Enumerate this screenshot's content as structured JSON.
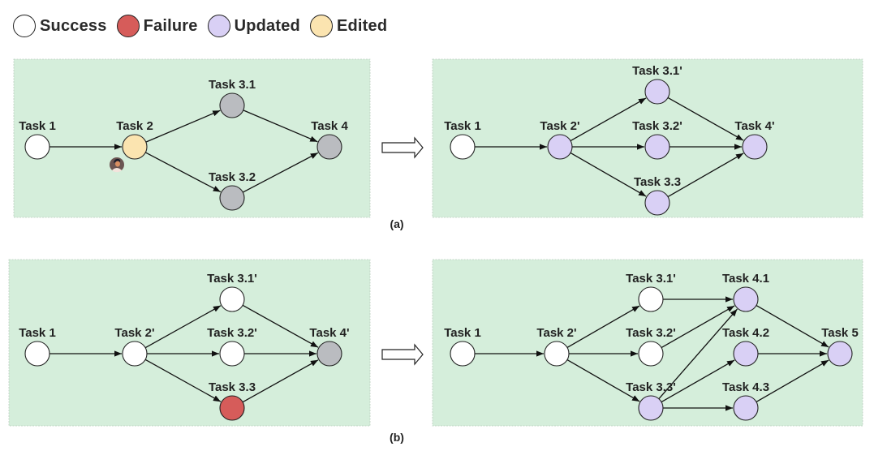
{
  "legend": [
    {
      "label": "Success",
      "status": "success"
    },
    {
      "label": "Failure",
      "status": "failure"
    },
    {
      "label": "Updated",
      "status": "updated"
    },
    {
      "label": "Edited",
      "status": "edited"
    }
  ],
  "status_colors": {
    "success": "#ffffff",
    "failure": "#d65c5a",
    "updated": "#d9d0f5",
    "edited": "#fbe4b0",
    "pending": "#babcc0"
  },
  "panel_color": "#d5eedb",
  "captions": {
    "a": "(a)",
    "b": "(b)"
  },
  "panels": [
    {
      "id": "a-before",
      "nodes": [
        {
          "id": "t1",
          "label": "Task 1",
          "status": "success"
        },
        {
          "id": "t2",
          "label": "Task 2",
          "status": "edited",
          "has_user_avatar": true
        },
        {
          "id": "t31",
          "label": "Task 3.1",
          "status": "pending"
        },
        {
          "id": "t32",
          "label": "Task 3.2",
          "status": "pending"
        },
        {
          "id": "t4",
          "label": "Task 4",
          "status": "pending"
        }
      ],
      "edges": [
        [
          "t1",
          "t2"
        ],
        [
          "t2",
          "t31"
        ],
        [
          "t2",
          "t32"
        ],
        [
          "t31",
          "t4"
        ],
        [
          "t32",
          "t4"
        ]
      ]
    },
    {
      "id": "a-after",
      "nodes": [
        {
          "id": "t1",
          "label": "Task 1",
          "status": "success"
        },
        {
          "id": "t2",
          "label": "Task 2'",
          "status": "updated"
        },
        {
          "id": "t31",
          "label": "Task 3.1'",
          "status": "updated"
        },
        {
          "id": "t32",
          "label": "Task 3.2'",
          "status": "updated"
        },
        {
          "id": "t33",
          "label": "Task 3.3",
          "status": "updated"
        },
        {
          "id": "t4",
          "label": "Task 4'",
          "status": "updated"
        }
      ],
      "edges": [
        [
          "t1",
          "t2"
        ],
        [
          "t2",
          "t31"
        ],
        [
          "t2",
          "t32"
        ],
        [
          "t2",
          "t33"
        ],
        [
          "t31",
          "t4"
        ],
        [
          "t32",
          "t4"
        ],
        [
          "t33",
          "t4"
        ]
      ]
    },
    {
      "id": "b-before",
      "nodes": [
        {
          "id": "t1",
          "label": "Task 1",
          "status": "success"
        },
        {
          "id": "t2",
          "label": "Task 2'",
          "status": "success"
        },
        {
          "id": "t31",
          "label": "Task 3.1'",
          "status": "success"
        },
        {
          "id": "t32",
          "label": "Task 3.2'",
          "status": "success"
        },
        {
          "id": "t33",
          "label": "Task 3.3",
          "status": "failure"
        },
        {
          "id": "t4",
          "label": "Task 4'",
          "status": "pending"
        }
      ],
      "edges": [
        [
          "t1",
          "t2"
        ],
        [
          "t2",
          "t31"
        ],
        [
          "t2",
          "t32"
        ],
        [
          "t2",
          "t33"
        ],
        [
          "t31",
          "t4"
        ],
        [
          "t32",
          "t4"
        ],
        [
          "t33",
          "t4"
        ]
      ]
    },
    {
      "id": "b-after",
      "nodes": [
        {
          "id": "t1",
          "label": "Task 1",
          "status": "success"
        },
        {
          "id": "t2",
          "label": "Task 2'",
          "status": "success"
        },
        {
          "id": "t31",
          "label": "Task 3.1'",
          "status": "success"
        },
        {
          "id": "t32",
          "label": "Task 3.2'",
          "status": "success"
        },
        {
          "id": "t33",
          "label": "Task 3.3'",
          "status": "updated"
        },
        {
          "id": "t41",
          "label": "Task 4.1",
          "status": "updated"
        },
        {
          "id": "t42",
          "label": "Task 4.2",
          "status": "updated"
        },
        {
          "id": "t43",
          "label": "Task 4.3",
          "status": "updated"
        },
        {
          "id": "t5",
          "label": "Task 5",
          "status": "updated"
        }
      ],
      "edges": [
        [
          "t1",
          "t2"
        ],
        [
          "t2",
          "t31"
        ],
        [
          "t2",
          "t32"
        ],
        [
          "t2",
          "t33"
        ],
        [
          "t31",
          "t41"
        ],
        [
          "t32",
          "t41"
        ],
        [
          "t33",
          "t41"
        ],
        [
          "t33",
          "t42"
        ],
        [
          "t33",
          "t43"
        ],
        [
          "t41",
          "t5"
        ],
        [
          "t42",
          "t5"
        ],
        [
          "t43",
          "t5"
        ]
      ]
    }
  ]
}
